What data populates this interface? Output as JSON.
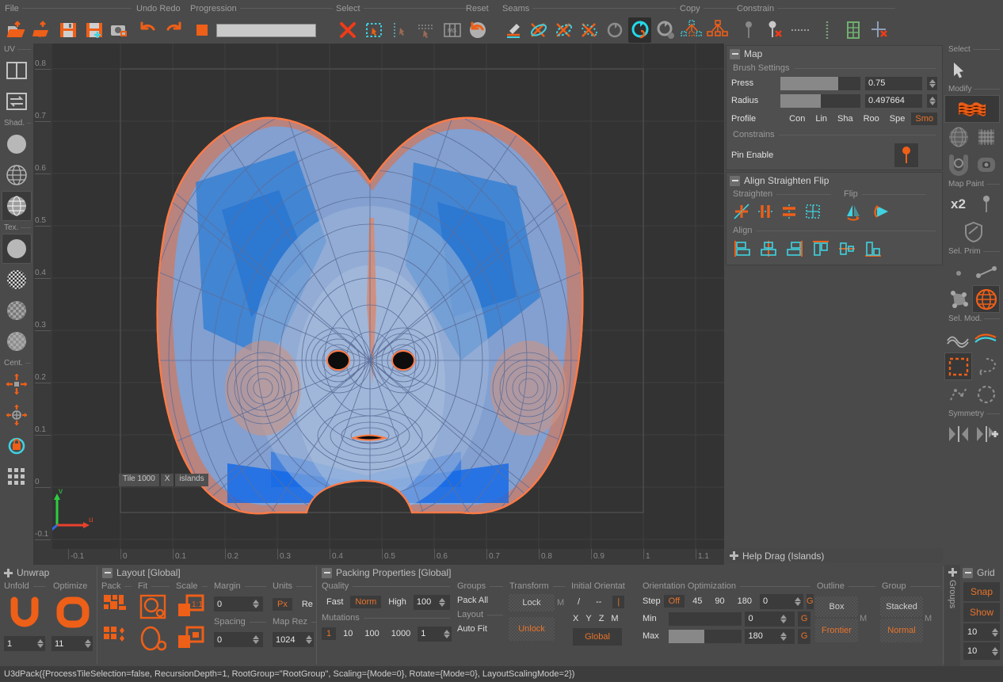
{
  "toolbar": {
    "sections": [
      {
        "label": "File",
        "icons": [
          "open-folder-icon",
          "open-uv-folder-icon",
          "save-icon",
          "save-as-icon",
          "screenshot-icon"
        ]
      },
      {
        "label": "Undo Redo",
        "icons": [
          "undo-icon",
          "redo-icon"
        ]
      },
      {
        "label": "Progression",
        "icons": [
          "stop-square-icon"
        ]
      },
      {
        "label": "Select",
        "icons": [
          "delete-cross-icon",
          "rect-select-icon",
          "pointer-select-icon",
          "edge-select-icon",
          "grid-select-icon"
        ]
      },
      {
        "label": "Reset",
        "icons": [
          "reset-arrow-icon"
        ]
      },
      {
        "label": "Seams",
        "icons": [
          "cut-pen-icon",
          "cut-seam-icon",
          "weld-seam-icon",
          "unweld-seam-icon",
          "flip-normals-icon",
          "mirror-sync-icon",
          "copy-sync-icon"
        ]
      },
      {
        "label": "Copy",
        "icons": [
          "copy-islands-icon",
          "paste-islands-icon"
        ]
      },
      {
        "label": "Constrain",
        "icons": [
          "pin-grey-icon",
          "pin-remove-icon",
          "edge-constrain-icon",
          "pin-column-icon",
          "grid-constrain-icon",
          "axis-remove-icon"
        ]
      }
    ],
    "progression_value": ""
  },
  "left_sidebar": {
    "groups": [
      {
        "label": "UV",
        "items": [
          "split-view-icon",
          "swap-view-icon"
        ]
      },
      {
        "label": "Shad.",
        "items": [
          "flat-shading-icon",
          "wire-shading-icon",
          "wire-shaded-icon"
        ]
      },
      {
        "label": "Tex.",
        "items": [
          "plain-texture-icon",
          "checker-texture-icon",
          "checker-blur-icon",
          "checker-soft-icon"
        ]
      },
      {
        "label": "Cent.",
        "items": [
          "center-move-icon",
          "center-pivot-icon",
          "rotate-lock-icon",
          "grid-toggle-icon"
        ]
      }
    ]
  },
  "viewport": {
    "y_ticks": [
      "0.8",
      "0.7",
      "0.6",
      "0.5",
      "0.4",
      "0.3",
      "0.2",
      "0.1",
      "0",
      "-0.1"
    ],
    "x_ticks": [
      "-0.1",
      "0",
      "0.1",
      "0.2",
      "0.3",
      "0.4",
      "0.5",
      "0.6",
      "0.7",
      "0.8",
      "0.9",
      "1",
      "1.1"
    ],
    "tile_label": "Tile 1000",
    "tile_x": "X",
    "tile_islands": "islands",
    "axis_u": "u",
    "axis_v": "v",
    "mesh_fill": "#7b9fd4",
    "mesh_accent": "#1f6fd0",
    "mesh_border": "#ff7a45"
  },
  "map_panel": {
    "title": "Map",
    "brush_settings_label": "Brush Settings",
    "press_label": "Press",
    "press_value": "0.75",
    "press_fill_pct": 72,
    "radius_label": "Radius",
    "radius_value": "0.497664",
    "radius_fill_pct": 50,
    "profile_label": "Profile",
    "profile_options": [
      "Con",
      "Lin",
      "Sha",
      "Roo",
      "Spe",
      "Smo"
    ],
    "profile_selected": "Smo",
    "constrains_label": "Constrains",
    "pin_enable_label": "Pin Enable",
    "pin_icon": "pin-icon"
  },
  "align_panel": {
    "title": "Align Straighten Flip",
    "straighten_label": "Straighten",
    "straighten_icons": [
      "straighten-diagonal-icon",
      "straighten-horizontal-icon",
      "straighten-vertical-icon",
      "straighten-box-icon"
    ],
    "flip_label": "Flip",
    "flip_icons": [
      "flip-horizontal-icon",
      "flip-vertical-icon"
    ],
    "align_label": "Align",
    "align_icons": [
      "align-left-icon",
      "align-center-h-icon",
      "align-right-icon",
      "align-top-icon",
      "align-middle-v-icon",
      "align-bottom-icon"
    ]
  },
  "help_drag": {
    "label": "Help Drag (Islands)"
  },
  "tool_rail": {
    "select_label": "Select",
    "select_icons": [
      "cursor-arrow-icon"
    ],
    "modify_label": "Modify",
    "modify_icons": [
      "flag-mesh-icon",
      "sphere-grid-icon",
      "plane-grid-icon",
      "unfold-u-icon",
      "unfold-box-icon"
    ],
    "map_paint_label": "Map Paint",
    "map_paint_icons": [
      "x2-icon",
      "pin-paint-icon",
      "shield-icon"
    ],
    "sel_prim_label": "Sel. Prim",
    "sel_prim_icons": [
      "vertex-icon",
      "edge-icon",
      "polygon-icon",
      "island-icon"
    ],
    "sel_mod_label": "Sel. Mod.",
    "sel_mod_icons": [
      "loop-wave-icon",
      "border-wave-icon",
      "rect-marquee-icon",
      "lasso-icon",
      "path-select-icon",
      "circle-select-icon"
    ],
    "symmetry_label": "Symmetry",
    "symmetry_icons": [
      "symmetry-mirror-icon",
      "symmetry-add-icon"
    ],
    "x2_label": "x2"
  },
  "unwrap_panel": {
    "title": "Unwrap",
    "unfold_label": "Unfold",
    "unfold_icon": "unfold-u-icon",
    "unfold_value": "1",
    "optimize_label": "Optimize",
    "optimize_icon": "optimize-o-icon",
    "optimize_value": "11"
  },
  "layout_panel": {
    "title": "Layout [Global]",
    "pack_label": "Pack",
    "pack_icons": [
      "pack-grid-icon",
      "pack-scatter-icon"
    ],
    "fit_label": "Fit",
    "fit_icons": [
      "fit-square-icon",
      "fit-ellipse-icon"
    ],
    "scale_label": "Scale",
    "scale_icons": [
      "scale-one-icon",
      "scale-box-icon"
    ],
    "margin_label": "Margin",
    "margin_value": "0",
    "spacing_label": "Spacing",
    "spacing_value": "0",
    "units_label": "Units",
    "units_options": [
      "Px",
      "Re"
    ],
    "units_selected": "Px",
    "map_rez_label": "Map Rez",
    "map_rez_value": "1024"
  },
  "packing_panel": {
    "title": "Packing Properties [Global]",
    "quality_label": "Quality",
    "quality_options": [
      "Fast",
      "Norm",
      "High"
    ],
    "quality_selected": "Norm",
    "quality_value": "100",
    "mutations_label": "Mutations",
    "mutations_options": [
      "1",
      "10",
      "100",
      "1000"
    ],
    "mutations_selected": "1",
    "mutations_value": "1",
    "groups_label": "Groups",
    "pack_all_label": "Pack All",
    "layout_label": "Layout",
    "auto_fit_label": "Auto Fit",
    "transform_label": "Transform",
    "lock_label": "Lock",
    "unlock_label": "Unlock",
    "transform_m": "M",
    "initial_orient_label": "Initial Orientat",
    "orient_slash_options": [
      "/",
      "--",
      "|"
    ],
    "orient_slash_selected": "|",
    "orient_axis_options": [
      "X",
      "Y",
      "Z",
      "M"
    ],
    "global_label": "Global",
    "orient_opt_label": "Orientation Optimization",
    "step_label": "Step",
    "step_options": [
      "Off",
      "45",
      "90",
      "180"
    ],
    "step_selected": "Off",
    "step_value": "0",
    "min_label": "Min",
    "min_value": "0",
    "min_fill_pct": 0,
    "max_label": "Max",
    "max_value": "180",
    "max_fill_pct": 48,
    "g_label": "G",
    "outline_label": "Outline",
    "outline_options": [
      "Box",
      "Frontier"
    ],
    "outline_selected": "Frontier",
    "outline_m": "M",
    "group_label": "Group",
    "group_options": [
      "Stacked",
      "Normal"
    ],
    "group_selected": "Normal",
    "group_m": "M"
  },
  "groups_tab": {
    "label": "Groups"
  },
  "grid_panel": {
    "title": "Grid",
    "snap_label": "Snap",
    "show_label": "Show",
    "value_x": "10",
    "value_y": "10"
  },
  "status_bar": {
    "text": "U3dPack({ProcessTileSelection=false, RecursionDepth=1, RootGroup=\"RootGroup\", Scaling={Mode=0}, Rotate={Mode=0}, LayoutScalingMode=2})"
  },
  "colors": {
    "orange": "#e8732a",
    "cyan": "#3fd2e0",
    "panel": "#4a4a4a",
    "dark": "#333333"
  }
}
